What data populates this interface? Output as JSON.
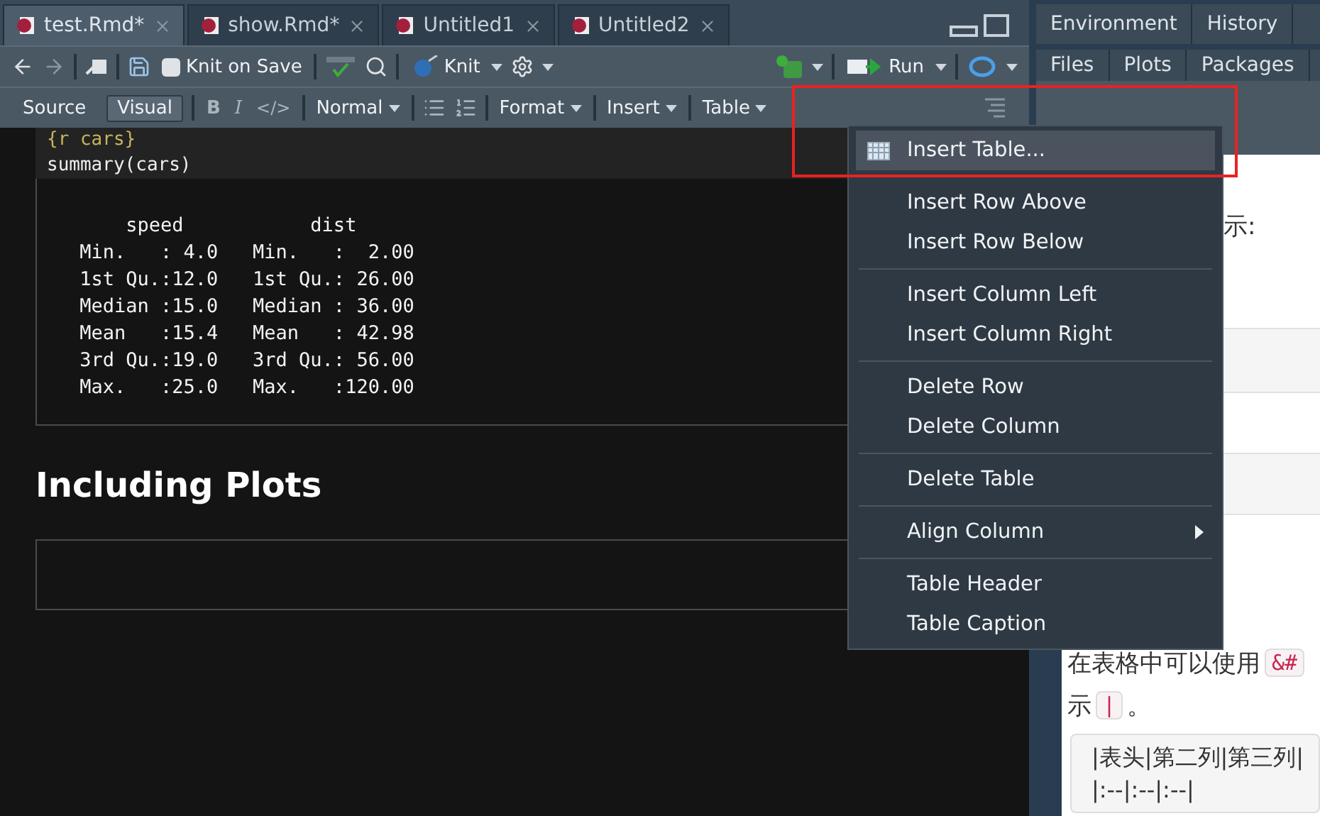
{
  "editor_tabs": [
    {
      "label": "test.Rmd*",
      "selected": true
    },
    {
      "label": "show.Rmd*",
      "selected": false
    },
    {
      "label": "Untitled1",
      "selected": false
    },
    {
      "label": "Untitled2",
      "selected": false
    }
  ],
  "toolbar": {
    "knit_on_save": {
      "label": "Knit on Save",
      "checked": false
    },
    "knit": "Knit",
    "run": "Run"
  },
  "format_bar": {
    "modes": [
      {
        "label": "Source",
        "selected": false
      },
      {
        "label": "Visual",
        "selected": true
      }
    ],
    "bold": "B",
    "italic": "I",
    "code": "</>",
    "style": "Normal",
    "format": "Format",
    "insert": "Insert",
    "table": "Table"
  },
  "document": {
    "chunk_header": "{r cars}",
    "code": "summary(cars)",
    "output": [
      "     speed           dist",
      " Min.   : 4.0   Min.   :  2.00",
      " 1st Qu.:12.0   1st Qu.: 26.00",
      " Median :15.0   Median : 36.00",
      " Mean   :15.4   Mean   : 42.98",
      " 3rd Qu.:19.0   3rd Qu.: 56.00",
      " Max.   :25.0   Max.   :120.00"
    ],
    "heading": "Including Plots"
  },
  "table_menu": {
    "groups": [
      [
        {
          "label": "Insert Table...",
          "kind": "table",
          "selected": true
        }
      ],
      [
        {
          "label": "Insert Row Above",
          "kind": "plain",
          "selected": false
        },
        {
          "label": "Insert Row Below",
          "kind": "plain",
          "selected": false
        }
      ],
      [
        {
          "label": "Insert Column Left",
          "kind": "plain",
          "selected": false
        },
        {
          "label": "Insert Column Right",
          "kind": "plain",
          "selected": false
        }
      ],
      [
        {
          "label": "Delete Row",
          "kind": "plain",
          "selected": false
        },
        {
          "label": "Delete Column",
          "kind": "plain",
          "selected": false
        }
      ],
      [
        {
          "label": "Delete Table",
          "kind": "plain",
          "selected": false
        }
      ],
      [
        {
          "label": "Align Column",
          "kind": "submenu",
          "selected": false
        }
      ],
      [
        {
          "label": "Table Header",
          "kind": "plain",
          "selected": false
        },
        {
          "label": "Table Caption",
          "kind": "plain",
          "selected": false
        }
      ]
    ]
  },
  "right_pane": {
    "top_tabs": [
      "Environment",
      "History"
    ],
    "bottom_tabs": [
      "Files",
      "Plots",
      "Packages"
    ],
    "content": {
      "line_1": "示:",
      "line_2": {
        "text": "在表格中可以使用",
        "code": "&#"
      },
      "line_3": {
        "before": "示",
        "code": "|",
        "after": "。"
      },
      "code_block": [
        "|表头|第二列|第三列|",
        "|:--|:--|:--|"
      ]
    }
  }
}
